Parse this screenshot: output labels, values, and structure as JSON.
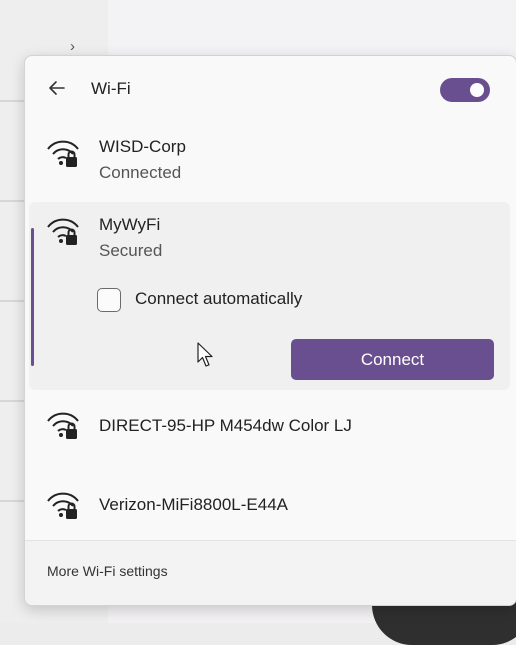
{
  "header": {
    "title": "Wi-Fi",
    "wifi_enabled": true,
    "accent_color": "#6a4f90"
  },
  "networks": [
    {
      "name": "WISD-Corp",
      "status": "Connected",
      "secured": true
    },
    {
      "name": "MyWyFi",
      "status": "Secured",
      "secured": true,
      "connect_automatically_label": "Connect automatically",
      "connect_automatically_checked": false,
      "connect_label": "Connect"
    },
    {
      "name": "DIRECT-95-HP M454dw Color LJ",
      "secured": true
    },
    {
      "name": "Verizon-MiFi8800L-E44A",
      "secured": true
    }
  ],
  "footer": {
    "link_label": "More Wi-Fi settings"
  },
  "icons": {
    "back": "arrow-left-icon",
    "network": "wifi-lock-icon",
    "cursor": "mouse-pointer-icon"
  }
}
